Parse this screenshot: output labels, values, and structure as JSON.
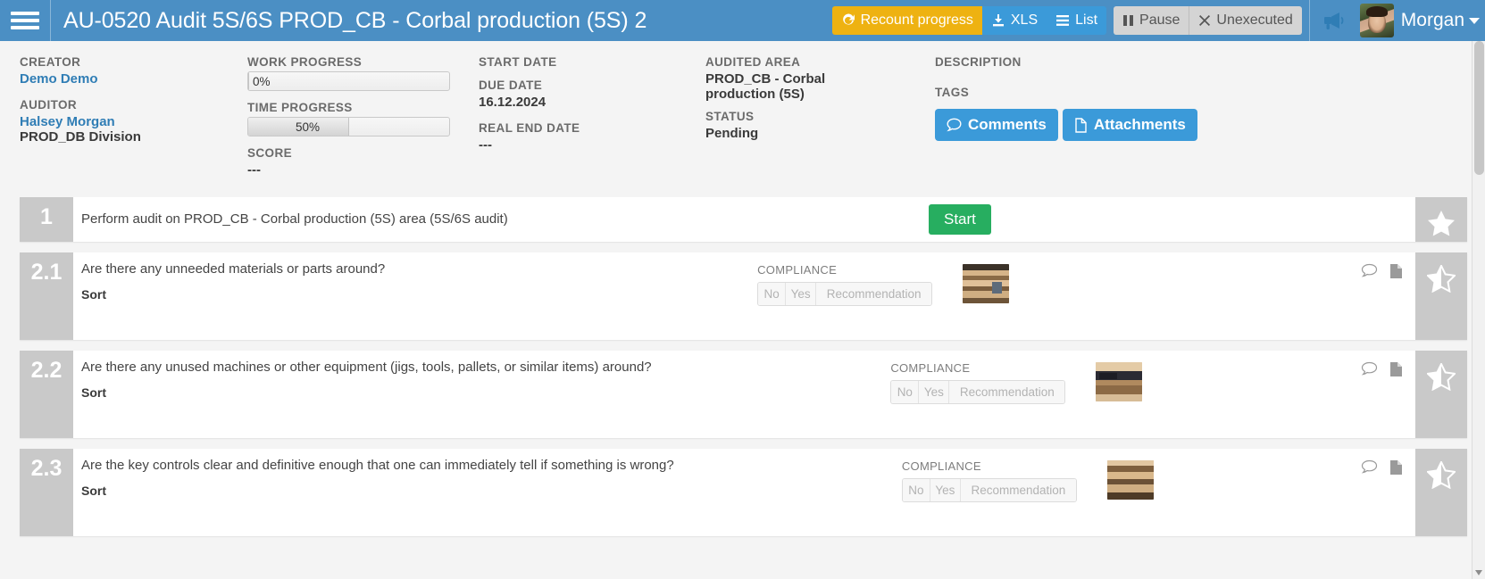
{
  "topbar": {
    "menu_icon": "hamburger-icon",
    "title": "AU-0520 Audit 5S/6S PROD_CB - Corbal production (5S) 2",
    "buttons": [
      {
        "label": "Recount progress",
        "icon": "refresh-icon",
        "style": "yellow"
      },
      {
        "label": "XLS",
        "icon": "download-icon",
        "style": "blue"
      },
      {
        "label": "List",
        "icon": "list-icon",
        "style": "blue"
      },
      {
        "label": "Pause",
        "icon": "pause-icon",
        "style": "grey"
      },
      {
        "label": "Unexecuted",
        "icon": "times-icon",
        "style": "grey"
      }
    ],
    "announce_icon": "megaphone-icon",
    "user_name": "Morgan",
    "user_caret": "chevron-down-icon",
    "bg_color": "#4b8fc4"
  },
  "info": {
    "creator_label": "CREATOR",
    "creator_value": "Demo Demo",
    "auditor_label": "AUDITOR",
    "auditor_value": "Halsey Morgan",
    "auditor_division": "PROD_DB Division",
    "work_progress_label": "WORK PROGRESS",
    "work_progress_value": "0%",
    "work_progress_pct": 0,
    "time_progress_label": "TIME PROGRESS",
    "time_progress_value": "50%",
    "time_progress_pct": 50,
    "score_label": "SCORE",
    "score_value": "---",
    "start_date_label": "START DATE",
    "start_date_value": "",
    "due_date_label": "DUE DATE",
    "due_date_value": "16.12.2024",
    "real_end_date_label": "REAL END DATE",
    "real_end_date_value": "---",
    "audited_area_label": "AUDITED AREA",
    "audited_area_value": "PROD_CB - Corbal production (5S)",
    "status_label": "STATUS",
    "status_value": "Pending",
    "description_label": "DESCRIPTION",
    "tags_label": "TAGS",
    "comments_button": "Comments",
    "attachments_button": "Attachments",
    "accent_color": "#3b9ad9"
  },
  "tasks": [
    {
      "number": "1",
      "title": "Perform audit on PROD_CB - Corbal production (5S) area (5S/6S audit)",
      "subtitle": "",
      "action_button": "Start",
      "star": "filled",
      "type": "task"
    },
    {
      "number": "2.1",
      "title": "Are there any unneeded materials or parts around?",
      "subtitle": "Sort",
      "compliance_label": "COMPLIANCE",
      "compliance_options": [
        "No",
        "Yes",
        "Recommendation"
      ],
      "comment_icon": "comment-icon",
      "file_icon": "file-icon",
      "star": "half",
      "type": "question"
    },
    {
      "number": "2.2",
      "title": "Are there any unused machines or other equipment (jigs, tools, pallets, or similar items) around?",
      "subtitle": "Sort",
      "compliance_label": "COMPLIANCE",
      "compliance_options": [
        "No",
        "Yes",
        "Recommendation"
      ],
      "comment_icon": "comment-icon",
      "file_icon": "file-icon",
      "star": "half",
      "type": "question"
    },
    {
      "number": "2.3",
      "title": "Are the key controls clear and definitive enough that one can immediately tell if something is wrong?",
      "subtitle": "Sort",
      "compliance_label": "COMPLIANCE",
      "compliance_options": [
        "No",
        "Yes",
        "Recommendation"
      ],
      "comment_icon": "comment-icon",
      "file_icon": "file-icon",
      "star": "half",
      "type": "question"
    }
  ]
}
